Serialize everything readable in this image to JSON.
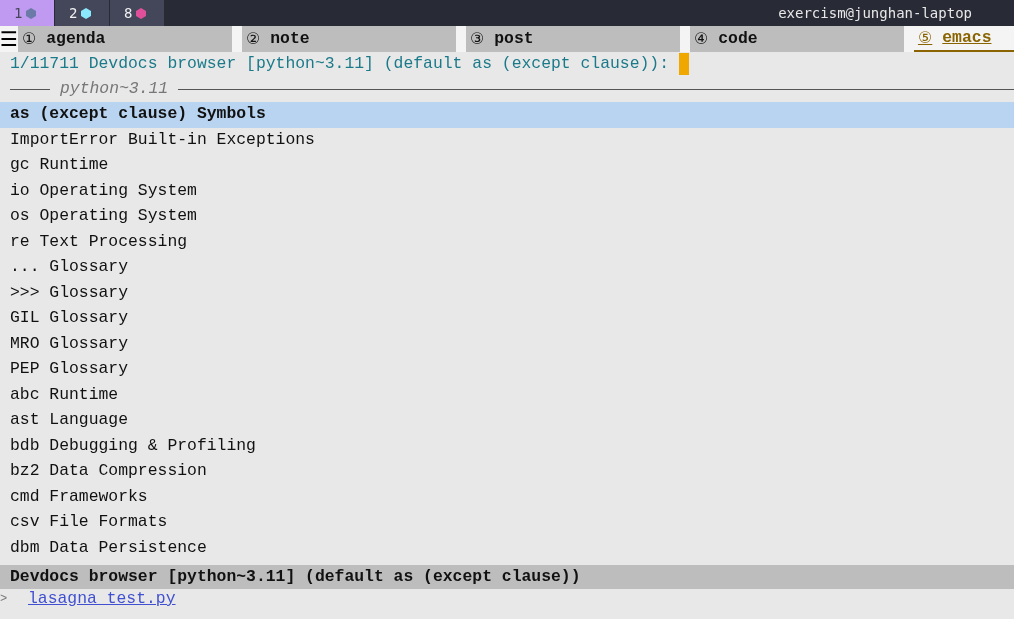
{
  "workspaces": [
    {
      "label": "1",
      "color": "#6c7aa8",
      "selected": true
    },
    {
      "label": "2",
      "color": "#8be9fd",
      "selected": false
    },
    {
      "label": "8",
      "color": "#e0509a",
      "selected": false
    }
  ],
  "window_title": "exercism@junghan-laptop",
  "menu_icon": "☰",
  "tabs": [
    {
      "number": "①",
      "label": "agenda",
      "selected": false
    },
    {
      "number": "②",
      "label": "note",
      "selected": false
    },
    {
      "number": "③",
      "label": "post",
      "selected": false
    },
    {
      "number": "④",
      "label": "code",
      "selected": false
    },
    {
      "number": "⑤",
      "label": "emacs",
      "selected": true
    }
  ],
  "prompt": "1/11711 Devdocs browser [python~3.11] (default as (except clause)):",
  "group_title": "python~3.11",
  "candidates": [
    {
      "name": "as (except clause)",
      "category": "Symbols",
      "selected": true
    },
    {
      "name": "ImportError",
      "category": "Built-in Exceptions",
      "selected": false
    },
    {
      "name": "gc",
      "category": "Runtime",
      "selected": false
    },
    {
      "name": "io",
      "category": "Operating System",
      "selected": false
    },
    {
      "name": "os",
      "category": "Operating System",
      "selected": false
    },
    {
      "name": "re",
      "category": "Text Processing",
      "selected": false
    },
    {
      "name": "...",
      "category": "Glossary",
      "selected": false
    },
    {
      "name": ">>>",
      "category": "Glossary",
      "selected": false
    },
    {
      "name": "GIL",
      "category": "Glossary",
      "selected": false
    },
    {
      "name": "MRO",
      "category": "Glossary",
      "selected": false
    },
    {
      "name": "PEP",
      "category": "Glossary",
      "selected": false
    },
    {
      "name": "abc",
      "category": "Runtime",
      "selected": false
    },
    {
      "name": "ast",
      "category": "Language",
      "selected": false
    },
    {
      "name": "bdb",
      "category": "Debugging & Profiling",
      "selected": false
    },
    {
      "name": "bz2",
      "category": "Data Compression",
      "selected": false
    },
    {
      "name": "cmd",
      "category": "Frameworks",
      "selected": false
    },
    {
      "name": "csv",
      "category": "File Formats",
      "selected": false
    },
    {
      "name": "dbm",
      "category": "Data Persistence",
      "selected": false
    }
  ],
  "mode_line": "Devdocs browser [python~3.11] (default as (except clause))",
  "next_line": {
    "marker": ">",
    "file": "lasagna_test.py"
  }
}
